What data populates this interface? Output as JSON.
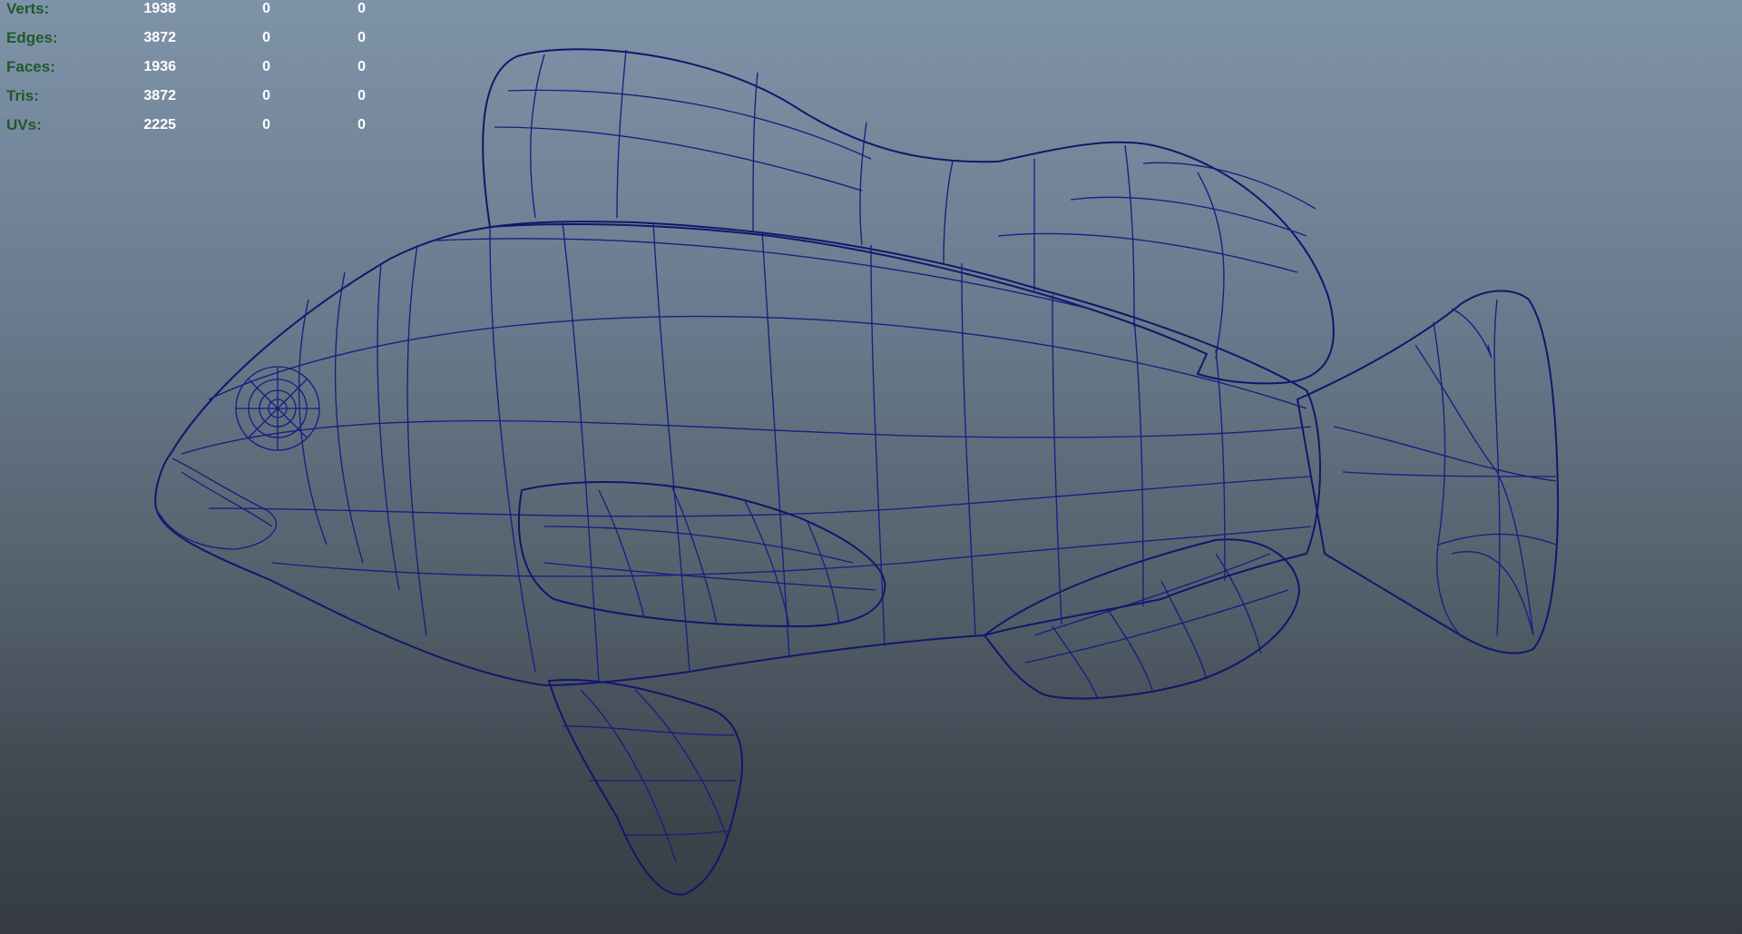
{
  "hud": {
    "rows": [
      {
        "label": "Verts:",
        "values": [
          "1938",
          "0",
          "0"
        ]
      },
      {
        "label": "Edges:",
        "values": [
          "3872",
          "0",
          "0"
        ]
      },
      {
        "label": "Faces:",
        "values": [
          "1936",
          "0",
          "0"
        ]
      },
      {
        "label": "Tris:",
        "values": [
          "3872",
          "0",
          "0"
        ]
      },
      {
        "label": "UVs:",
        "values": [
          "2225",
          "0",
          "0"
        ]
      }
    ]
  },
  "scene": {
    "model": "fish-mesh",
    "display_mode": "wireframe-on-shaded",
    "colors": {
      "background_top": "#7f93a8",
      "background_bottom": "#353b41",
      "mesh_fill": "#7b7b7b",
      "wire": "#1a1d80",
      "label": "#1f5a2a",
      "value": "#ffffff"
    }
  }
}
